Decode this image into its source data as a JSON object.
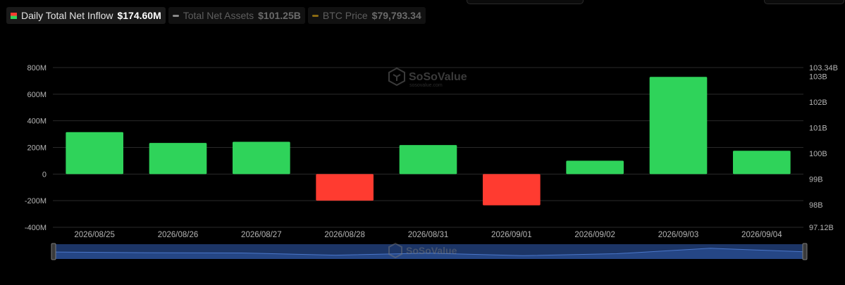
{
  "legend": [
    {
      "label": "Daily Total Net Inflow",
      "value": "$174.60M",
      "active": true,
      "icon": "split-bar-icon"
    },
    {
      "label": "Total Net Assets",
      "value": "$101.25B",
      "active": false,
      "icon": "line-icon",
      "color": "#8a8a8a"
    },
    {
      "label": "BTC Price",
      "value": "$79,793.34",
      "active": false,
      "icon": "line-icon",
      "color": "#8a6a12"
    }
  ],
  "watermark": {
    "name": "SoSoValue",
    "url": "sosovalue.com"
  },
  "colors": {
    "positive": "#2fd35a",
    "negative": "#ff3b30",
    "axis_text": "#b5b5b5",
    "grid": "#2a2a2a",
    "navigator_fill": "#1c3566",
    "navigator_line": "#4a76c9"
  },
  "chart_data": {
    "type": "bar",
    "categories": [
      "2026/08/25",
      "2026/08/26",
      "2026/08/27",
      "2026/08/28",
      "2026/08/31",
      "2026/09/01",
      "2026/09/02",
      "2026/09/03",
      "2026/09/04"
    ],
    "series": [
      {
        "name": "Daily Total Net Inflow",
        "unit": "USD M",
        "values": [
          315,
          234,
          242,
          -200,
          218,
          -235,
          100,
          730,
          174.6
        ]
      }
    ],
    "y_left": {
      "ticks": [
        800,
        600,
        400,
        200,
        0,
        -200,
        -400
      ],
      "tick_labels": [
        "800M",
        "600M",
        "400M",
        "200M",
        "0",
        "-200M",
        "-400M"
      ],
      "ylim": [
        -400,
        800
      ]
    },
    "y_right": {
      "tick_labels": [
        "103.34B",
        "103B",
        "102B",
        "101B",
        "100B",
        "99B",
        "98B",
        "97.12B"
      ],
      "tick_values": [
        103.34,
        103,
        102,
        101,
        100,
        99,
        98,
        97.12
      ],
      "ylim": [
        97.12,
        103.34
      ]
    },
    "grid": true,
    "legend_position": "top-left",
    "navigator": {
      "shape": [
        0.42,
        0.35,
        0.32,
        0.1,
        0.3,
        0.05,
        0.25,
        0.8,
        0.45
      ]
    }
  }
}
